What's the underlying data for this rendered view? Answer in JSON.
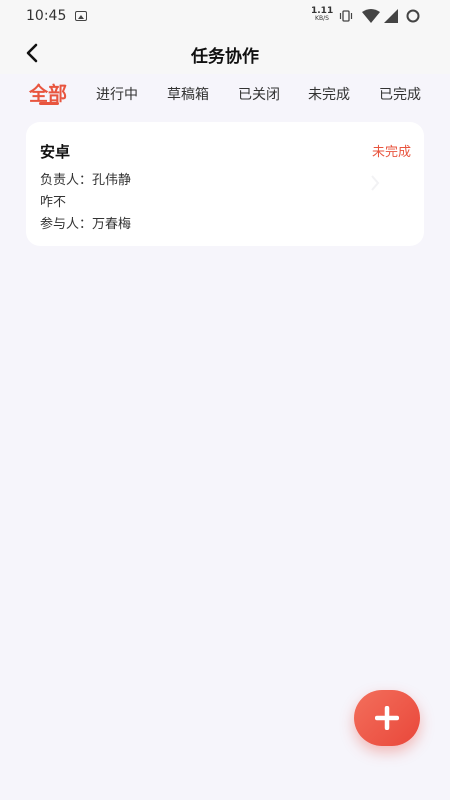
{
  "status_bar": {
    "time": "10:45",
    "net_speed_value": "1.11",
    "net_speed_unit": "KB/S",
    "icons": [
      "photo-icon",
      "vibrate-icon",
      "wifi-icon",
      "signal-icon",
      "battery-icon"
    ]
  },
  "header": {
    "title": "任务协作",
    "back_icon": "chevron-left-icon"
  },
  "tabs": {
    "items": [
      {
        "label": "全部",
        "active": true
      },
      {
        "label": "进行中",
        "active": false
      },
      {
        "label": "草稿箱",
        "active": false
      },
      {
        "label": "已关闭",
        "active": false
      },
      {
        "label": "未完成",
        "active": false
      },
      {
        "label": "已完成",
        "active": false
      }
    ]
  },
  "tasks": [
    {
      "title": "安卓",
      "status": "未完成",
      "owner_line": "负责人：孔伟静",
      "desc_line": "咋不",
      "participant_line": "参与人：万春梅"
    }
  ],
  "fab": {
    "icon": "plus-icon"
  },
  "colors": {
    "accent": "#e8553f",
    "background": "#f6f5fb",
    "card": "#ffffff"
  }
}
